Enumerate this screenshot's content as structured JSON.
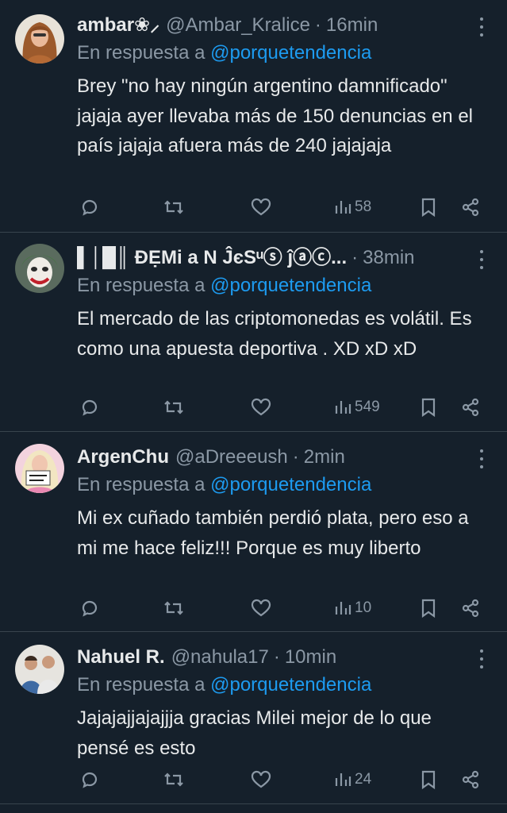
{
  "tweets": [
    {
      "name": "ambar❀⸝",
      "handle": "@Ambar_Kralice",
      "time": "16min",
      "reply_prefix": "En respuesta a",
      "reply_to": "@porquetendencia",
      "text": "Brey \"no hay ningún argentino damnificado\" jajaja ayer llevaba más de 150 denuncias en el país jajaja afuera más de 240 jajajaja",
      "views": "58",
      "avatar_icon": "woman-long-hair-avatar"
    },
    {
      "name": "▌│█║ ĐẸMi a N ĴєЅᵘⓢ ĵⓐⓒ...",
      "handle": "",
      "time": "38min",
      "reply_prefix": "En respuesta a",
      "reply_to": "@porquetendencia",
      "text": "El mercado de las criptomonedas es volátil. Es como una apuesta deportiva . XD xD xD",
      "views": "549",
      "avatar_icon": "joker-face-avatar"
    },
    {
      "name": "ArgenChu",
      "handle": "@aDreeeush",
      "time": "2min",
      "reply_prefix": "En respuesta a",
      "reply_to": "@porquetendencia",
      "text": "Mi ex cuñado también perdió plata, pero eso a mi me hace feliz!!! Porque es muy liberto",
      "views": "10",
      "avatar_icon": "blonde-with-sign-avatar"
    },
    {
      "name": "Nahuel R.",
      "handle": "@nahula17",
      "time": "10min",
      "reply_prefix": "En respuesta a",
      "reply_to": "@porquetendencia",
      "text": "Jajajajjajajjja gracias Milei mejor de lo que pensé es esto",
      "views": "24",
      "avatar_icon": "two-men-avatar"
    }
  ],
  "colors": {
    "background": "#15202b",
    "text": "#e7e9ea",
    "muted": "#8b98a5",
    "link": "#1d9bf0",
    "divider": "#38444d"
  }
}
